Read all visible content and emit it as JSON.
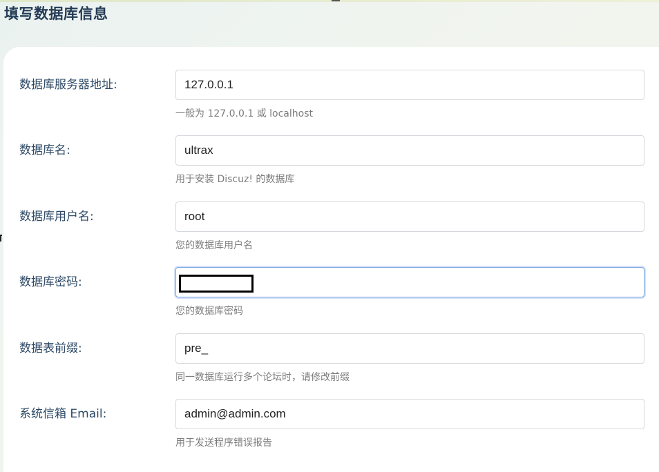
{
  "page": {
    "title": "填写数据库信息"
  },
  "form": {
    "fields": [
      {
        "label": "数据库服务器地址:",
        "value": "127.0.0.1",
        "hint": "一般为 127.0.0.1 或 localhost"
      },
      {
        "label": "数据库名:",
        "value": "ultrax",
        "hint": "用于安装 Discuz! 的数据库"
      },
      {
        "label": "数据库用户名:",
        "value": "root",
        "hint": "您的数据库用户名"
      },
      {
        "label": "数据库密码:",
        "value": "",
        "hint": "您的数据库密码"
      },
      {
        "label": "数据表前缀:",
        "value": "pre_",
        "hint": "同一数据库运行多个论坛时，请修改前缀"
      },
      {
        "label": "系统信箱 Email:",
        "value": "admin@admin.com",
        "hint": "用于发送程序错误报告"
      }
    ]
  },
  "colors": {
    "title": "#243b55",
    "label": "#2e4a66",
    "hint": "#7c7c7c",
    "focus_border": "#7aa7e0"
  }
}
